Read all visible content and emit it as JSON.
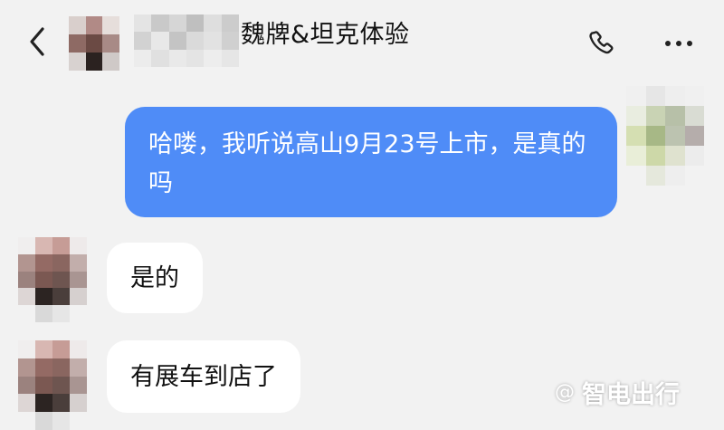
{
  "header": {
    "title": "魏牌&坦克体验",
    "icons": {
      "back": "chevron-left-icon",
      "call": "phone-icon",
      "more": "more-horizontal-icon"
    }
  },
  "messages": [
    {
      "direction": "outgoing",
      "text": "哈喽，我听说高山9月23号上市，是真的吗"
    },
    {
      "direction": "incoming",
      "text": "是的"
    },
    {
      "direction": "incoming",
      "text": "有展车到店了"
    }
  ],
  "colors": {
    "outgoing_bubble": "#4f8cf7",
    "incoming_bubble": "#ffffff",
    "background": "#f2f2f2"
  },
  "watermark": {
    "at": "@",
    "text": "智电出行"
  }
}
